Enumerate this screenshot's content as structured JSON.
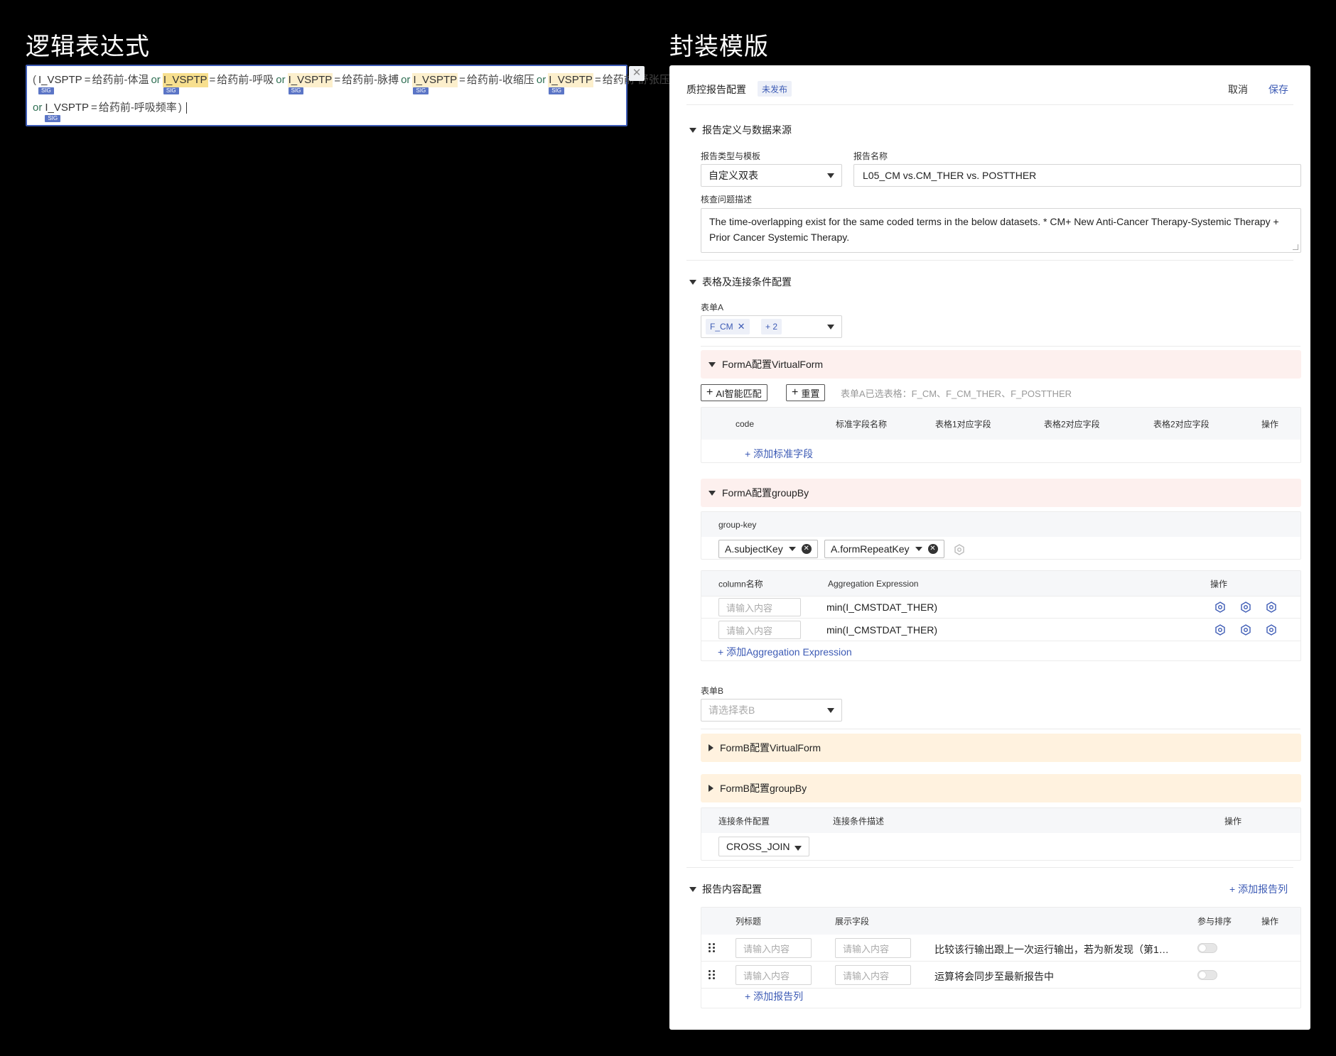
{
  "left": {
    "title": "逻辑表达式",
    "expression": {
      "line1": [
        {
          "var": "I_VSPTP",
          "hl": "",
          "sig": "SIG",
          "eq": "=",
          "val": "给药前-体温",
          "op": "or"
        },
        {
          "var": "I_VSPTP",
          "hl": "hl1",
          "sig": "SIG",
          "eq": "=",
          "val": "给药前-呼吸",
          "op": "or"
        },
        {
          "var": "I_VSPTP",
          "hl": "hl2",
          "sig": "SIG",
          "eq": "=",
          "val": "给药前-脉搏",
          "op": "or"
        },
        {
          "var": "I_VSPTP",
          "hl": "hl2",
          "sig": "SIG",
          "eq": "=",
          "val": "给药前-收缩压",
          "op": "or"
        },
        {
          "var": "I_VSPTP",
          "hl": "hl2",
          "sig": "SIG",
          "eq": "=",
          "val": "给药前-舒张压力",
          "op": ""
        }
      ],
      "line2": {
        "op": "or",
        "var": "I_VSPTP",
        "sig": "SIG",
        "eq": "=",
        "val": "给药前-呼吸频率",
        "close": ")"
      },
      "open": "(",
      "close_icon": "close-icon"
    }
  },
  "right": {
    "title": "封装模版",
    "header": {
      "title": "质控报告配置",
      "badge": "未发布",
      "cancel": "取消",
      "save": "保存"
    },
    "sec1": {
      "title": "报告定义与数据来源",
      "type_label": "报告类型与模板",
      "type_value": "自定义双表",
      "name_label": "报告名称",
      "name_value": "L05_CM vs.CM_THER vs. POSTTHER",
      "desc_label": "核查问题描述",
      "desc_value": "The time-overlapping exist for the same coded terms in the below datasets. * CM+ New Anti-Cancer Therapy-Systemic Therapy + Prior Cancer Systemic Therapy."
    },
    "sec2": {
      "title": "表格及连接条件配置",
      "formA_label": "表单A",
      "formA_chip": "F_CM",
      "formA_more": "+ 2",
      "vf_title": "FormA配置VirtualForm",
      "ai_btn": "AI智能匹配",
      "reset_btn": "重置",
      "selected_info": "表单A已选表格：F_CM、F_CM_THER、F_POSTTHER",
      "vf_cols": [
        "code",
        "标准字段名称",
        "表格1对应字段",
        "表格2对应字段",
        "表格2对应字段",
        "操作"
      ],
      "add_std": "+ 添加标准字段",
      "gb_title": "FormA配置groupBy",
      "gk_label": "group-key",
      "gk_tags": [
        "A.subjectKey",
        "A.formRepeatKey"
      ],
      "agg_cols": [
        "column名称",
        "Aggregation Expression",
        "操作"
      ],
      "agg_rows": [
        {
          "placeholder": "请输入内容",
          "expr": "min(I_CMSTDAT_THER)"
        },
        {
          "placeholder": "请输入内容",
          "expr": "min(I_CMSTDAT_THER)"
        }
      ],
      "add_agg": "+ 添加Aggregation Expression",
      "formB_label": "表单B",
      "formB_placeholder": "请选择表B",
      "formB_vf": "FormB配置VirtualForm",
      "formB_gb": "FormB配置groupBy",
      "join_cols": [
        "连接条件配置",
        "连接条件描述",
        "操作"
      ],
      "join_value": "CROSS_JOIN"
    },
    "sec3": {
      "title": "报告内容配置",
      "add_col_top": "+ 添加报告列",
      "cols": [
        "列标题",
        "展示字段",
        "参与排序",
        "操作"
      ],
      "rows": [
        {
          "p1": "请输入内容",
          "p2": "请输入内容",
          "desc": "比较该行输出跟上一次运行输出，若为新发现（第1…"
        },
        {
          "p1": "请输入内容",
          "p2": "请输入内容",
          "desc": "运算将会同步至最新报告中"
        }
      ],
      "add_col_bottom": "+ 添加报告列"
    }
  }
}
